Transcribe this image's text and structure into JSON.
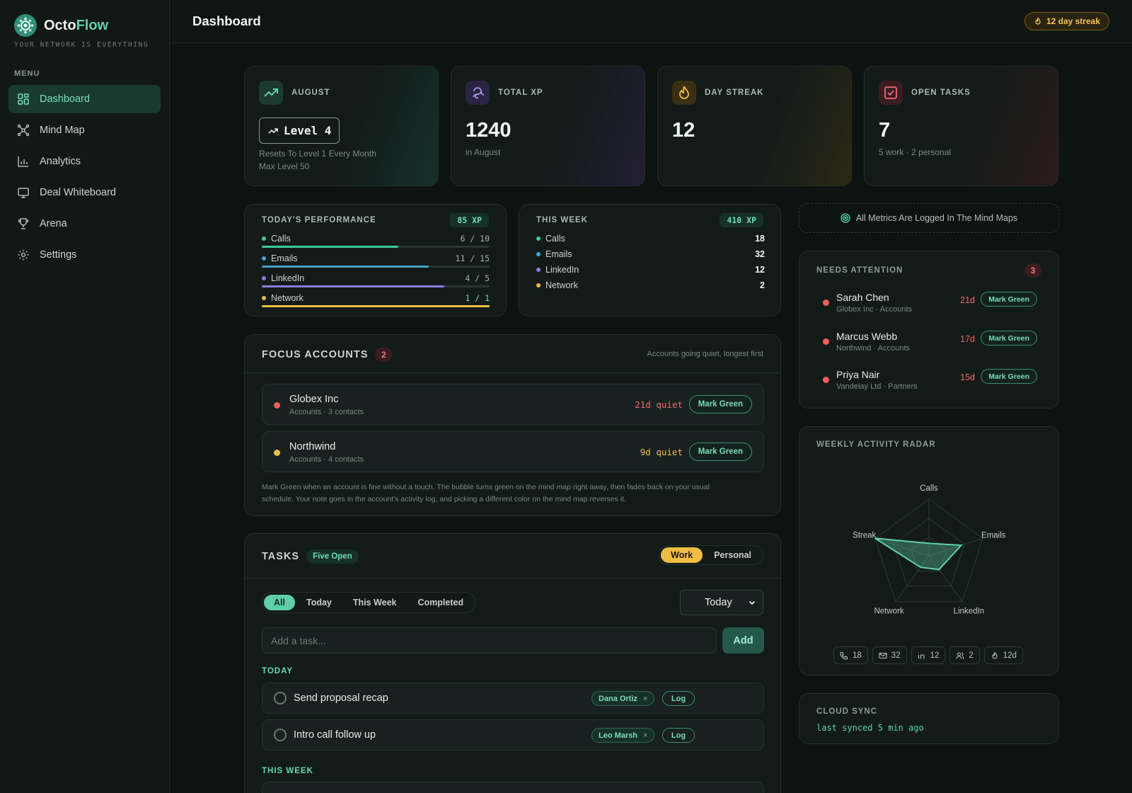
{
  "brand": {
    "name_a": "Octo",
    "name_b": "Flow",
    "tagline": "YOUR NETWORK IS EVERYTHING"
  },
  "sidebar": {
    "menu_label": "MENU",
    "items": [
      {
        "label": "Dashboard",
        "icon": "dashboard-icon"
      },
      {
        "label": "Mind Map",
        "icon": "mind-map-icon"
      },
      {
        "label": "Analytics",
        "icon": "chart-icon"
      },
      {
        "label": "Deal Whiteboard",
        "icon": "monitor-icon"
      },
      {
        "label": "Arena",
        "icon": "trophy-icon"
      },
      {
        "label": "Settings",
        "icon": "gear-icon"
      }
    ]
  },
  "header": {
    "title": "Dashboard",
    "streak": "12 day streak"
  },
  "stats": {
    "month": {
      "label": "AUGUST",
      "level": "Level 4",
      "note1": "Resets To Level 1 Every Month",
      "note2": "Max Level 50"
    },
    "xp": {
      "label": "TOTAL XP",
      "value": "1240",
      "sub": "in August"
    },
    "streak": {
      "label": "DAY STREAK",
      "value": "12"
    },
    "tasks": {
      "label": "OPEN TASKS",
      "value": "7",
      "sub": "5 work · 2 personal"
    }
  },
  "today": {
    "label": "TODAY'S PERFORMANCE",
    "xp": "85 XP",
    "rows": [
      {
        "name": "Calls",
        "count": "6 / 10",
        "done": 6,
        "goal": 10,
        "color": "#3fc99a"
      },
      {
        "name": "Emails",
        "count": "11 / 15",
        "done": 11,
        "goal": 15,
        "color": "#4a9fc9"
      },
      {
        "name": "LinkedIn",
        "count": "4 / 5",
        "done": 4,
        "goal": 5,
        "color": "#8a7fe0"
      },
      {
        "name": "Network",
        "count": "1 / 1",
        "done": 1,
        "goal": 1,
        "color": "#f0bc45"
      }
    ]
  },
  "week": {
    "label": "THIS WEEK",
    "xp": "410 XP",
    "rows": [
      {
        "name": "Calls",
        "value": "18",
        "color": "#3fc99a"
      },
      {
        "name": "Emails",
        "value": "32",
        "color": "#4a9fc9"
      },
      {
        "name": "LinkedIn",
        "value": "12",
        "color": "#8a7fe0"
      },
      {
        "name": "Network",
        "value": "2",
        "color": "#f0bc45"
      }
    ]
  },
  "metrics_note": "All Metrics Are Logged In The Mind Maps",
  "focus": {
    "title": "FOCUS ACCOUNTS",
    "count": "2",
    "hint": "Accounts going quiet, longest first",
    "accounts": [
      {
        "name": "Globex Inc",
        "sub": "Accounts · 3 contacts",
        "quiet": "21d quiet",
        "color": "#ef5f5f"
      },
      {
        "name": "Northwind",
        "sub": "Accounts · 4 contacts",
        "quiet": "9d quiet",
        "color": "#f0bc45"
      }
    ],
    "mark_label": "Mark Green",
    "footnote1": "Mark Green when an account is fine without a touch. The bubble turns green on the mind map right away, then fades back on your usual",
    "footnote2": "schedule. Your note goes in the account's activity log, and picking a different color on the mind map reverses it."
  },
  "tasks": {
    "title": "TASKS",
    "badge": "Five Open",
    "mode": [
      "Work",
      "Personal"
    ],
    "filters": [
      "All",
      "Today",
      "This Week",
      "Completed"
    ],
    "select_value": "Today",
    "placeholder": "Add a task...",
    "add_label": "Add",
    "group_today": "TODAY",
    "group_week": "THIS WEEK",
    "log_label": "Log",
    "items": [
      {
        "name": "Send proposal recap",
        "person": "Dana Ortiz"
      },
      {
        "name": "Intro call follow up",
        "person": "Leo Marsh"
      }
    ]
  },
  "attention": {
    "title": "NEEDS ATTENTION",
    "count": "3",
    "rows": [
      {
        "name": "Sarah Chen",
        "sub": "Globex Inc · Accounts",
        "days": "21d"
      },
      {
        "name": "Marcus Webb",
        "sub": "Northwind · Accounts",
        "days": "17d"
      },
      {
        "name": "Priya Nair",
        "sub": "Vandelay Ltd · Partners",
        "days": "15d"
      }
    ],
    "mark_label": "Mark Green"
  },
  "radar": {
    "title": "WEEKLY ACTIVITY RADAR",
    "axes": [
      "Calls",
      "Emails",
      "LinkedIn",
      "Network",
      "Streak"
    ],
    "values": [
      0.22,
      0.6,
      0.3,
      0.25,
      1.0
    ],
    "chips": [
      {
        "icon": "phone-icon",
        "value": "18"
      },
      {
        "icon": "mail-icon",
        "value": "32"
      },
      {
        "icon": "linkedin-icon",
        "value": "12"
      },
      {
        "icon": "people-icon",
        "value": "2"
      },
      {
        "icon": "flame-icon",
        "value": "12d"
      }
    ]
  },
  "sync": {
    "title": "CLOUD SYNC",
    "status": "last synced 5 min ago"
  }
}
